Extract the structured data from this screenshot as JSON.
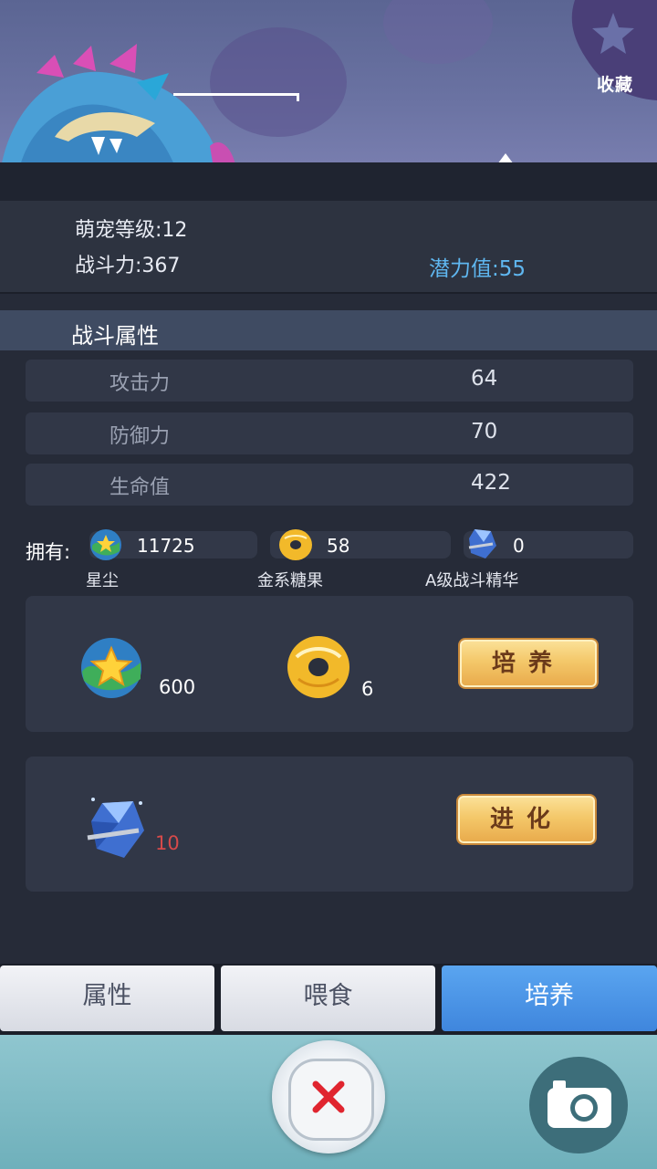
{
  "header": {
    "favorite_label": "收藏",
    "favorite_icon": "star-icon"
  },
  "info": {
    "level_label": "萌宠等级:",
    "level_value": "12",
    "power_label": "战斗力:",
    "power_value": "367",
    "potential_label": "潜力值:",
    "potential_value": "55"
  },
  "battle": {
    "title": "战斗属性",
    "stats": [
      {
        "name": "攻击力",
        "value": "64"
      },
      {
        "name": "防御力",
        "value": "70"
      },
      {
        "name": "生命值",
        "value": "422"
      }
    ]
  },
  "owned": {
    "label": "拥有:",
    "items": [
      {
        "name": "星尘",
        "value": "11725",
        "icon": "stardust-icon"
      },
      {
        "name": "金系糖果",
        "value": "58",
        "icon": "golden-candy-icon"
      },
      {
        "name": "A级战斗精华",
        "value": "0",
        "icon": "crystal-essence-icon"
      }
    ]
  },
  "train": {
    "stardust_cost": "600",
    "candy_cost": "6",
    "button_label": "培养"
  },
  "evolve": {
    "crystal_cost": "10",
    "button_label": "进化"
  },
  "tabs": [
    {
      "label": "属性",
      "active": false
    },
    {
      "label": "喂食",
      "active": false
    },
    {
      "label": "培养",
      "active": true
    }
  ],
  "colors": {
    "accent_blue": "#5fb7f0",
    "tab_active": "#4a92e4",
    "gold_button": "#f4c86a",
    "cost_red": "#d64a4a"
  }
}
